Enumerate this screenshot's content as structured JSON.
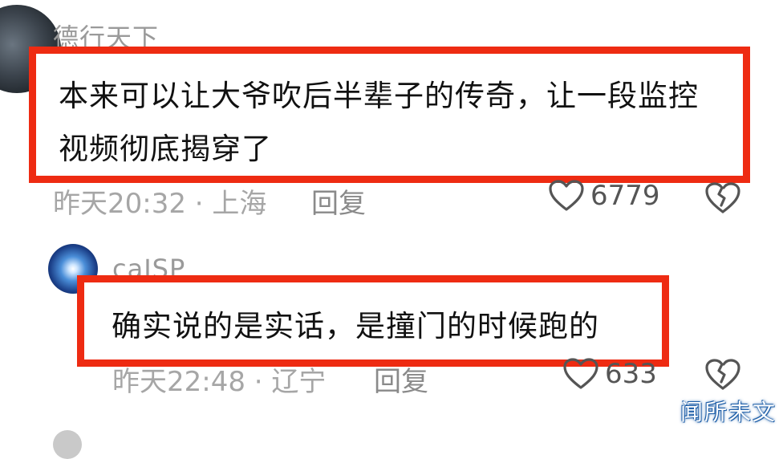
{
  "comments": [
    {
      "username": "德行天下",
      "text_line1": "本来可以让大爷吹后半辈子的传奇，让一段监控",
      "text_line2": "视频彻底揭穿了",
      "meta": "昨天20:32 · 上海",
      "reply_label": "回复",
      "like_count": "6779"
    },
    {
      "username": "caJSP",
      "text_line1": "确实说的是实话，是撞门的时候跑的",
      "meta": "昨天22:48 · 辽宁",
      "reply_label": "回复",
      "like_count": "633"
    }
  ],
  "watermark": "闻所未文",
  "icons": {
    "like": "heart-outline-icon",
    "dislike": "broken-heart-icon"
  },
  "colors": {
    "highlight_border": "#ee2b12",
    "meta_text": "#a6a6a6"
  }
}
